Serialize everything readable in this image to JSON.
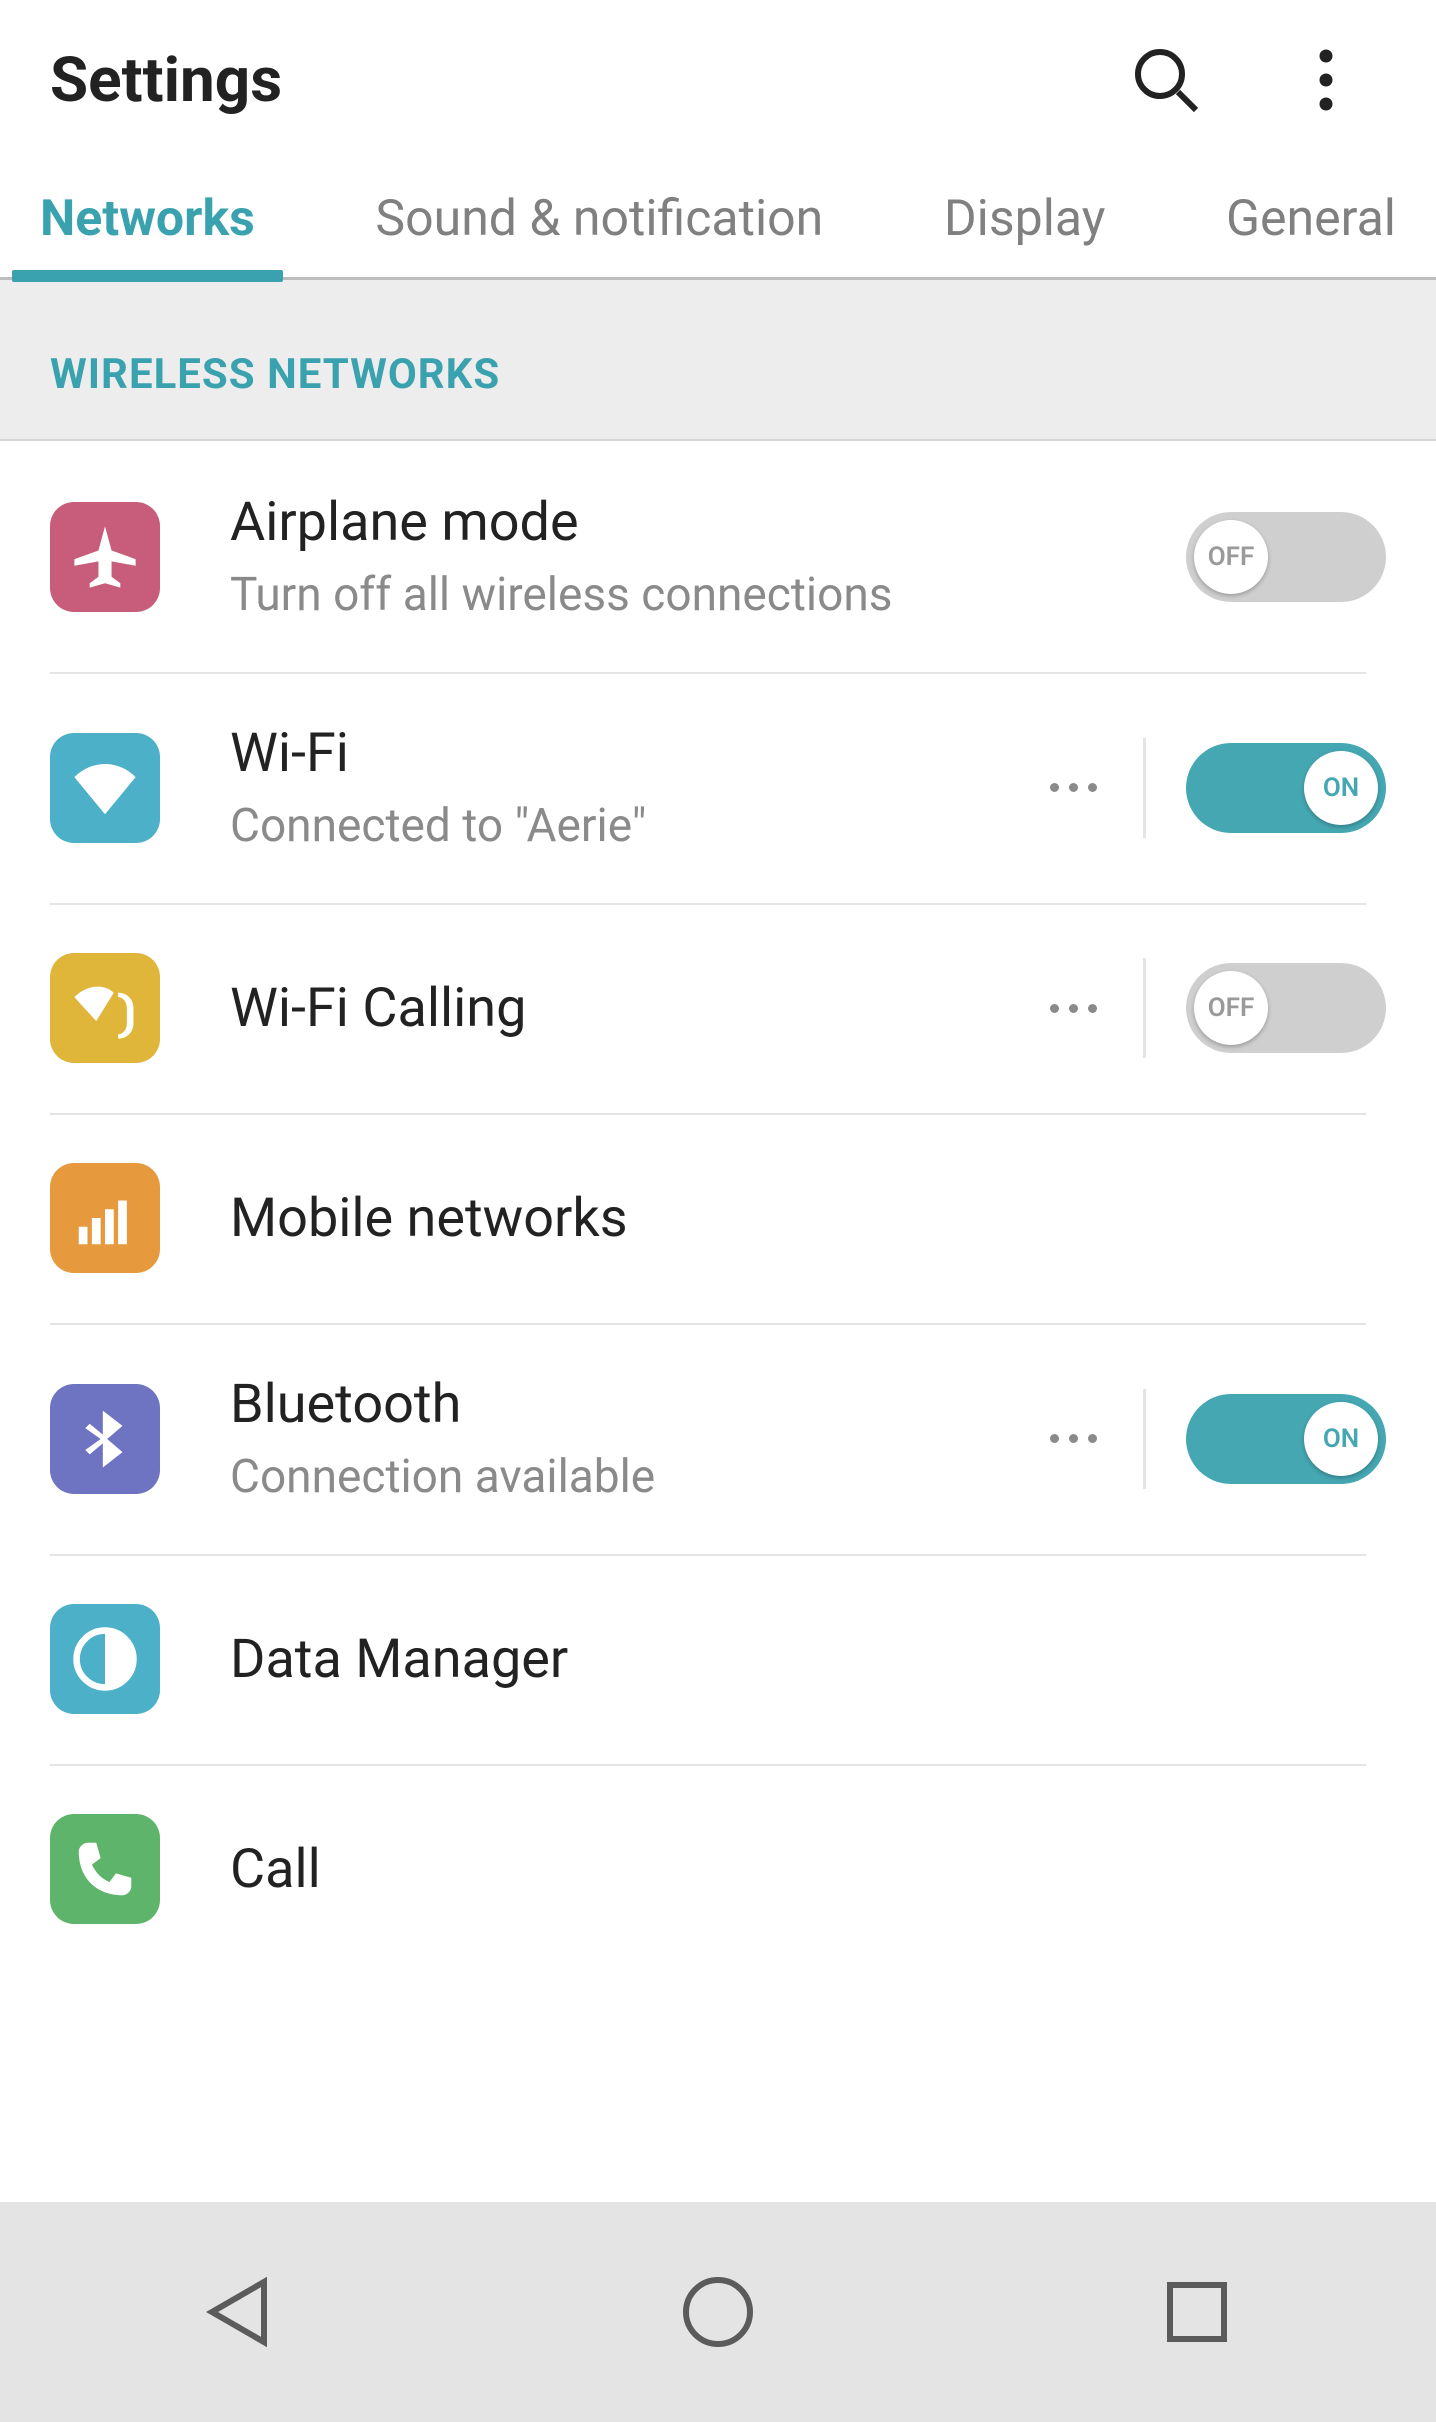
{
  "header": {
    "title": "Settings"
  },
  "tabs": [
    {
      "label": "Networks",
      "active": true
    },
    {
      "label": "Sound & notification",
      "active": false
    },
    {
      "label": "Display",
      "active": false
    },
    {
      "label": "General",
      "active": false
    }
  ],
  "section_header": "WIRELESS NETWORKS",
  "toggle_labels": {
    "on": "ON",
    "off": "OFF"
  },
  "rows": [
    {
      "id": "airplane",
      "title": "Airplane mode",
      "sub": "Turn off all wireless connections",
      "icon_bg": "bg-airplane",
      "toggle": "off",
      "more": false
    },
    {
      "id": "wifi",
      "title": "Wi-Fi",
      "sub": "Connected to \"Aerie\"",
      "icon_bg": "bg-wifi",
      "toggle": "on",
      "more": true
    },
    {
      "id": "wificall",
      "title": "Wi-Fi Calling",
      "sub": "",
      "icon_bg": "bg-wificall",
      "toggle": "off",
      "more": true
    },
    {
      "id": "mobile",
      "title": "Mobile networks",
      "sub": "",
      "icon_bg": "bg-mobile",
      "toggle": null,
      "more": false
    },
    {
      "id": "bluetooth",
      "title": "Bluetooth",
      "sub": "Connection available",
      "icon_bg": "bg-bt",
      "toggle": "on",
      "more": true
    },
    {
      "id": "data",
      "title": "Data Manager",
      "sub": "",
      "icon_bg": "bg-data",
      "toggle": null,
      "more": false
    },
    {
      "id": "call",
      "title": "Call",
      "sub": "",
      "icon_bg": "bg-call",
      "toggle": null,
      "more": false
    }
  ]
}
